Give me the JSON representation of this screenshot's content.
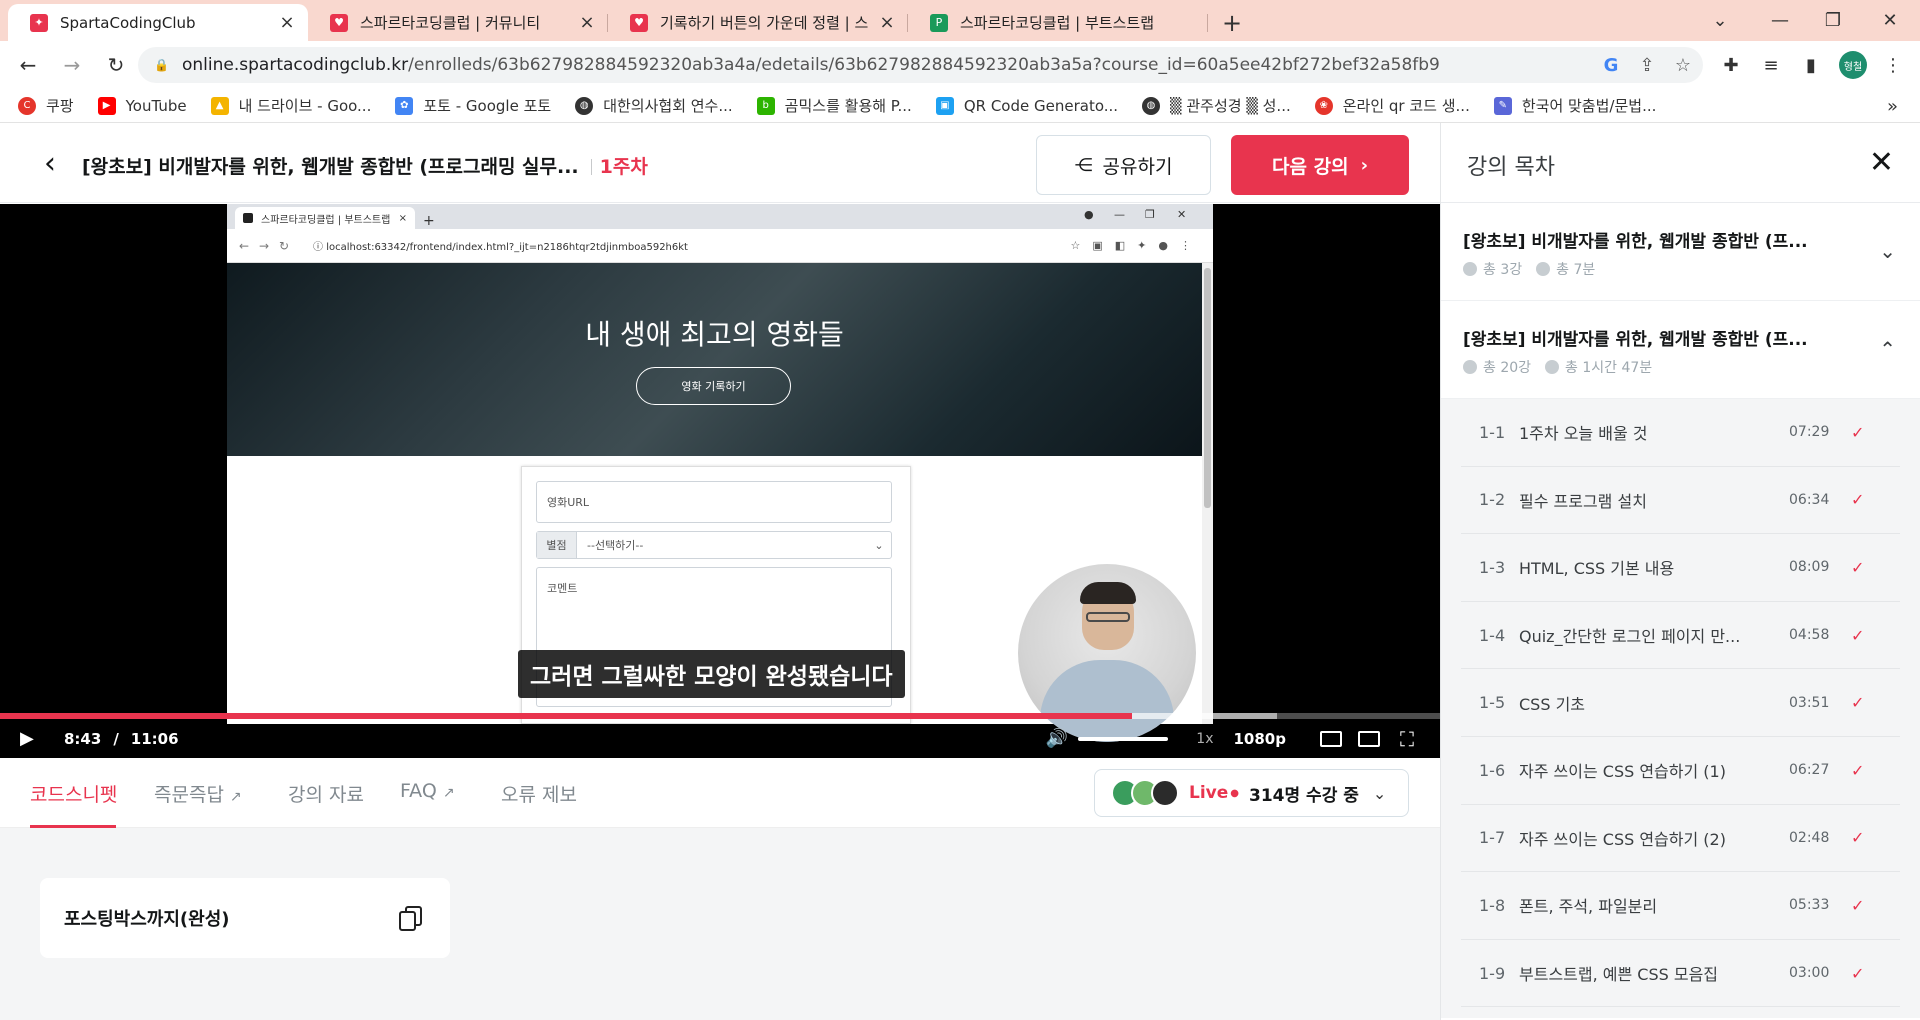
{
  "browser": {
    "tabs": [
      {
        "label": "SpartaCodingClub",
        "active": true,
        "favicon_color": "#e8344e"
      },
      {
        "label": "스파르타코딩클럽 | 커뮤니티",
        "active": false,
        "favicon_color": "#e8344e"
      },
      {
        "label": "기록하기 버튼의 가운데 정렬 | 스",
        "active": false,
        "favicon_color": "#e8344e"
      },
      {
        "label": "스파르타코딩클럽 | 부트스트랩",
        "active": false,
        "favicon_color": "#1a9a5a"
      }
    ],
    "url_host": "online.spartacodingclub.kr",
    "url_path": "/enrolleds/63b627982884592320ab3a4a/edetails/63b627982884592320ab3a5a?course_id=60a5ee42bf272bef32a58fb9",
    "profile_label": "형철",
    "bookmarks": [
      {
        "label": "쿠팡",
        "color": "#e5352b"
      },
      {
        "label": "YouTube",
        "color": "#ff0000"
      },
      {
        "label": "내 드라이브 - Goo...",
        "color": "#f4b400"
      },
      {
        "label": "포토 - Google 포토",
        "color": "#4285f4"
      },
      {
        "label": "대한의사협회 연수...",
        "color": "#333333"
      },
      {
        "label": "곰믹스를 활용해 P...",
        "color": "#2db400"
      },
      {
        "label": "QR Code Generato...",
        "color": "#1da1f2"
      },
      {
        "label": "▒ 관주성경 ▒ 성...",
        "color": "#333333"
      },
      {
        "label": "온라인 qr 코드 생...",
        "color": "#e5352b"
      },
      {
        "label": "한국어 맞춤법/문법...",
        "color": "#5a67d8"
      }
    ]
  },
  "header": {
    "course_title": "[왕초보] 비개발자를 위한, 웹개발 종합반 (프로그래밍 실무...",
    "week": "1주차",
    "share_label": "공유하기",
    "next_label": "다음 강의"
  },
  "video": {
    "inner_tab_title": "스파르타코딩클럽 | 부트스트랩",
    "inner_url": "localhost:63342/frontend/index.html?_ijt=n2186htqr2tdjinmboa592h6kt",
    "hero_title": "내 생애 최고의 영화들",
    "hero_button": "영화 기록하기",
    "field_url_placeholder": "영화URL",
    "rating_addon": "별점",
    "rating_select": "--선택하기--",
    "comment_placeholder": "코멘트",
    "subtitle": "그러면 그럴싸한 모양이 완성됐습니다",
    "current_time": "8:43",
    "duration": "11:06",
    "played_fraction": 0.786,
    "buffered_fraction": 0.887,
    "speed": "1x",
    "quality": "1080p"
  },
  "subtabs": [
    {
      "label": "코드스니펫",
      "active": true,
      "external": false
    },
    {
      "label": "즉문즉답",
      "active": false,
      "external": true
    },
    {
      "label": "강의 자료",
      "active": false,
      "external": false
    },
    {
      "label": "FAQ",
      "active": false,
      "external": true
    },
    {
      "label": "오류 제보",
      "active": false,
      "external": false
    }
  ],
  "live": {
    "label": "Live",
    "count": "314명 수강 중"
  },
  "snippet": {
    "title": "포스팅박스까지(완성)"
  },
  "sidebar": {
    "title": "강의 목차",
    "sections": [
      {
        "title": "[왕초보] 비개발자를 위한, 웹개발 종합반 (프...",
        "lectures": "총 3강",
        "time": "총 7분",
        "expanded": false
      },
      {
        "title": "[왕초보] 비개발자를 위한, 웹개발 종합반 (프...",
        "lectures": "총 20강",
        "time": "총 1시간 47분",
        "expanded": true
      }
    ],
    "lessons": [
      {
        "no": "1-1",
        "name": "1주차 오늘 배울 것",
        "duration": "07:29"
      },
      {
        "no": "1-2",
        "name": "필수 프로그램 설치",
        "duration": "06:34"
      },
      {
        "no": "1-3",
        "name": "HTML, CSS 기본 내용",
        "duration": "08:09"
      },
      {
        "no": "1-4",
        "name": "Quiz_간단한 로그인 페이지 만...",
        "duration": "04:58"
      },
      {
        "no": "1-5",
        "name": "CSS 기초",
        "duration": "03:51"
      },
      {
        "no": "1-6",
        "name": "자주 쓰이는 CSS 연습하기 (1)",
        "duration": "06:27"
      },
      {
        "no": "1-7",
        "name": "자주 쓰이는 CSS 연습하기 (2)",
        "duration": "02:48"
      },
      {
        "no": "1-8",
        "name": "폰트, 주석, 파일분리",
        "duration": "05:33"
      },
      {
        "no": "1-9",
        "name": "부트스트랩, 예쁜 CSS 모음집",
        "duration": "03:00"
      }
    ]
  }
}
